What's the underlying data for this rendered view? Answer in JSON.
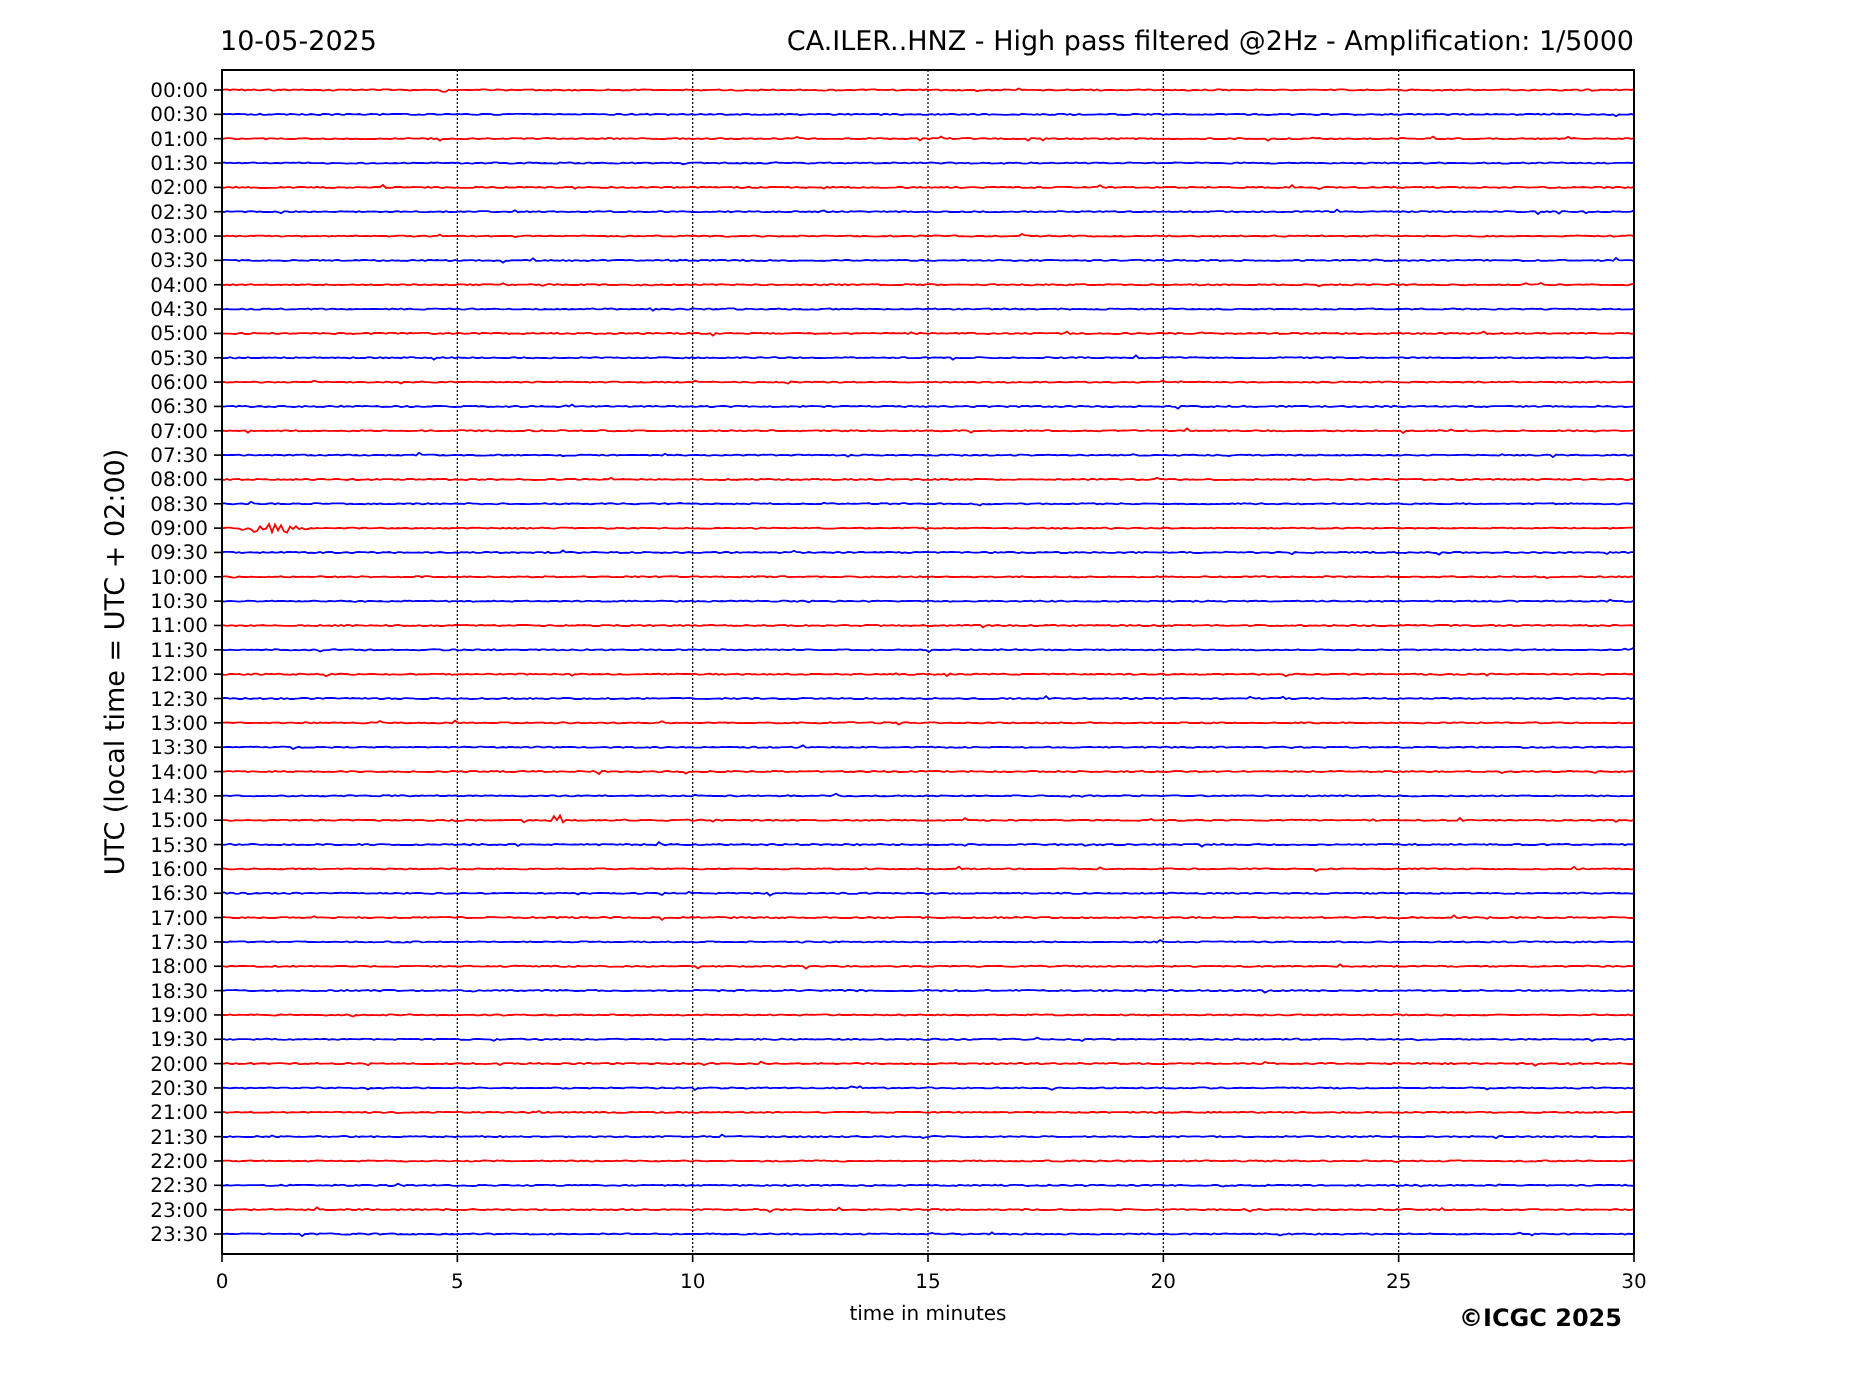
{
  "date": "10-05-2025",
  "title": "CA.ILER..HNZ - High pass filtered @2Hz - Amplification: 1/5000",
  "ylabel": "UTC (local time = UTC + 02:00)",
  "xlabel": "time in minutes",
  "xticks": [
    "0",
    "5",
    "10",
    "15",
    "20",
    "25",
    "30"
  ],
  "rows": [
    {
      "label": "00:00",
      "color": "#ff0000"
    },
    {
      "label": "00:30",
      "color": "#0000ff"
    },
    {
      "label": "01:00",
      "color": "#ff0000"
    },
    {
      "label": "01:30",
      "color": "#0000ff"
    },
    {
      "label": "02:00",
      "color": "#ff0000"
    },
    {
      "label": "02:30",
      "color": "#0000ff"
    },
    {
      "label": "03:00",
      "color": "#ff0000"
    },
    {
      "label": "03:30",
      "color": "#0000ff"
    },
    {
      "label": "04:00",
      "color": "#ff0000"
    },
    {
      "label": "04:30",
      "color": "#0000ff"
    },
    {
      "label": "05:00",
      "color": "#ff0000"
    },
    {
      "label": "05:30",
      "color": "#0000ff"
    },
    {
      "label": "06:00",
      "color": "#ff0000"
    },
    {
      "label": "06:30",
      "color": "#0000ff"
    },
    {
      "label": "07:00",
      "color": "#ff0000"
    },
    {
      "label": "07:30",
      "color": "#0000ff"
    },
    {
      "label": "08:00",
      "color": "#ff0000"
    },
    {
      "label": "08:30",
      "color": "#0000ff"
    },
    {
      "label": "09:00",
      "color": "#ff0000"
    },
    {
      "label": "09:30",
      "color": "#0000ff"
    },
    {
      "label": "10:00",
      "color": "#ff0000"
    },
    {
      "label": "10:30",
      "color": "#0000ff"
    },
    {
      "label": "11:00",
      "color": "#ff0000"
    },
    {
      "label": "11:30",
      "color": "#0000ff"
    },
    {
      "label": "12:00",
      "color": "#ff0000"
    },
    {
      "label": "12:30",
      "color": "#0000ff"
    },
    {
      "label": "13:00",
      "color": "#ff0000"
    },
    {
      "label": "13:30",
      "color": "#0000ff"
    },
    {
      "label": "14:00",
      "color": "#ff0000"
    },
    {
      "label": "14:30",
      "color": "#0000ff"
    },
    {
      "label": "15:00",
      "color": "#ff0000"
    },
    {
      "label": "15:30",
      "color": "#0000ff"
    },
    {
      "label": "16:00",
      "color": "#ff0000"
    },
    {
      "label": "16:30",
      "color": "#0000ff"
    },
    {
      "label": "17:00",
      "color": "#ff0000"
    },
    {
      "label": "17:30",
      "color": "#0000ff"
    },
    {
      "label": "18:00",
      "color": "#ff0000"
    },
    {
      "label": "18:30",
      "color": "#0000ff"
    },
    {
      "label": "19:00",
      "color": "#ff0000"
    },
    {
      "label": "19:30",
      "color": "#0000ff"
    },
    {
      "label": "20:00",
      "color": "#ff0000"
    },
    {
      "label": "20:30",
      "color": "#0000ff"
    },
    {
      "label": "21:00",
      "color": "#ff0000"
    },
    {
      "label": "21:30",
      "color": "#0000ff"
    },
    {
      "label": "22:00",
      "color": "#ff0000"
    },
    {
      "label": "22:30",
      "color": "#0000ff"
    },
    {
      "label": "23:00",
      "color": "#ff0000"
    },
    {
      "label": "23:30",
      "color": "#0000ff"
    }
  ],
  "copyright": "©ICGC 2025"
}
